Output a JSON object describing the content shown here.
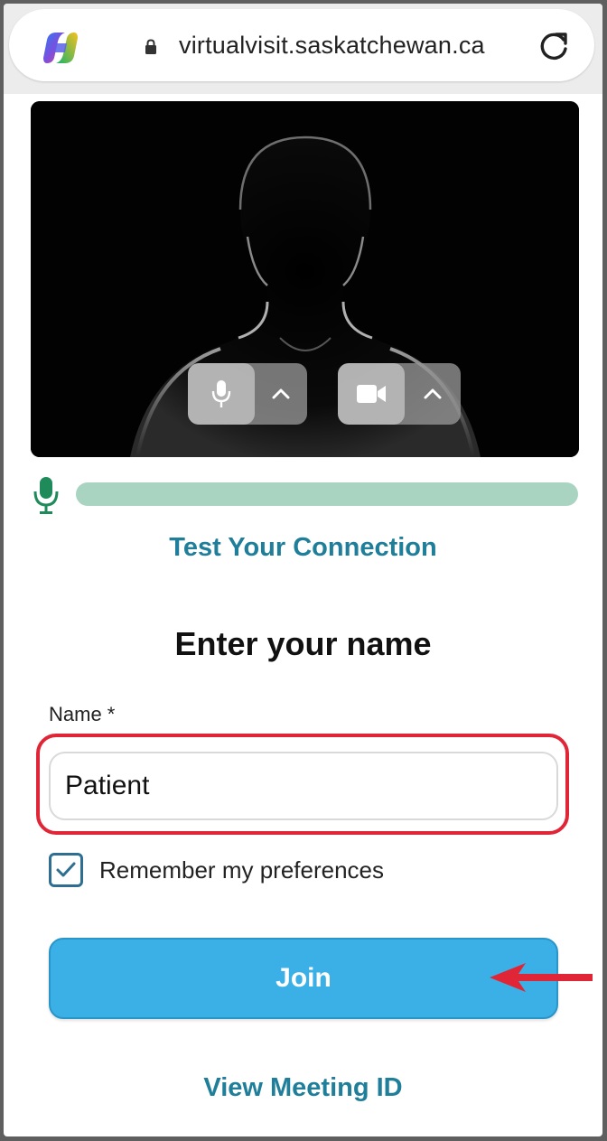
{
  "browser": {
    "url": "virtualvisit.saskatchewan.ca",
    "icons": [
      "copilot-icon",
      "lock-icon",
      "reload-icon"
    ]
  },
  "video": {
    "mic_icon": "microphone-icon",
    "camera_icon": "video-camera-icon",
    "caret_icon": "chevron-up-icon"
  },
  "audio_level": {
    "icon": "microphone-icon",
    "color": "#a9d4c1"
  },
  "links": {
    "test_connection": "Test Your Connection",
    "view_meeting_id": "View Meeting ID"
  },
  "form": {
    "heading": "Enter your name",
    "name_label": "Name *",
    "name_value": "Patient",
    "remember_label": "Remember my preferences",
    "remember_checked": true,
    "join_label": "Join"
  },
  "colors": {
    "accent": "#3bb0e6",
    "link": "#1f7f9a",
    "highlight": "#e02636"
  }
}
